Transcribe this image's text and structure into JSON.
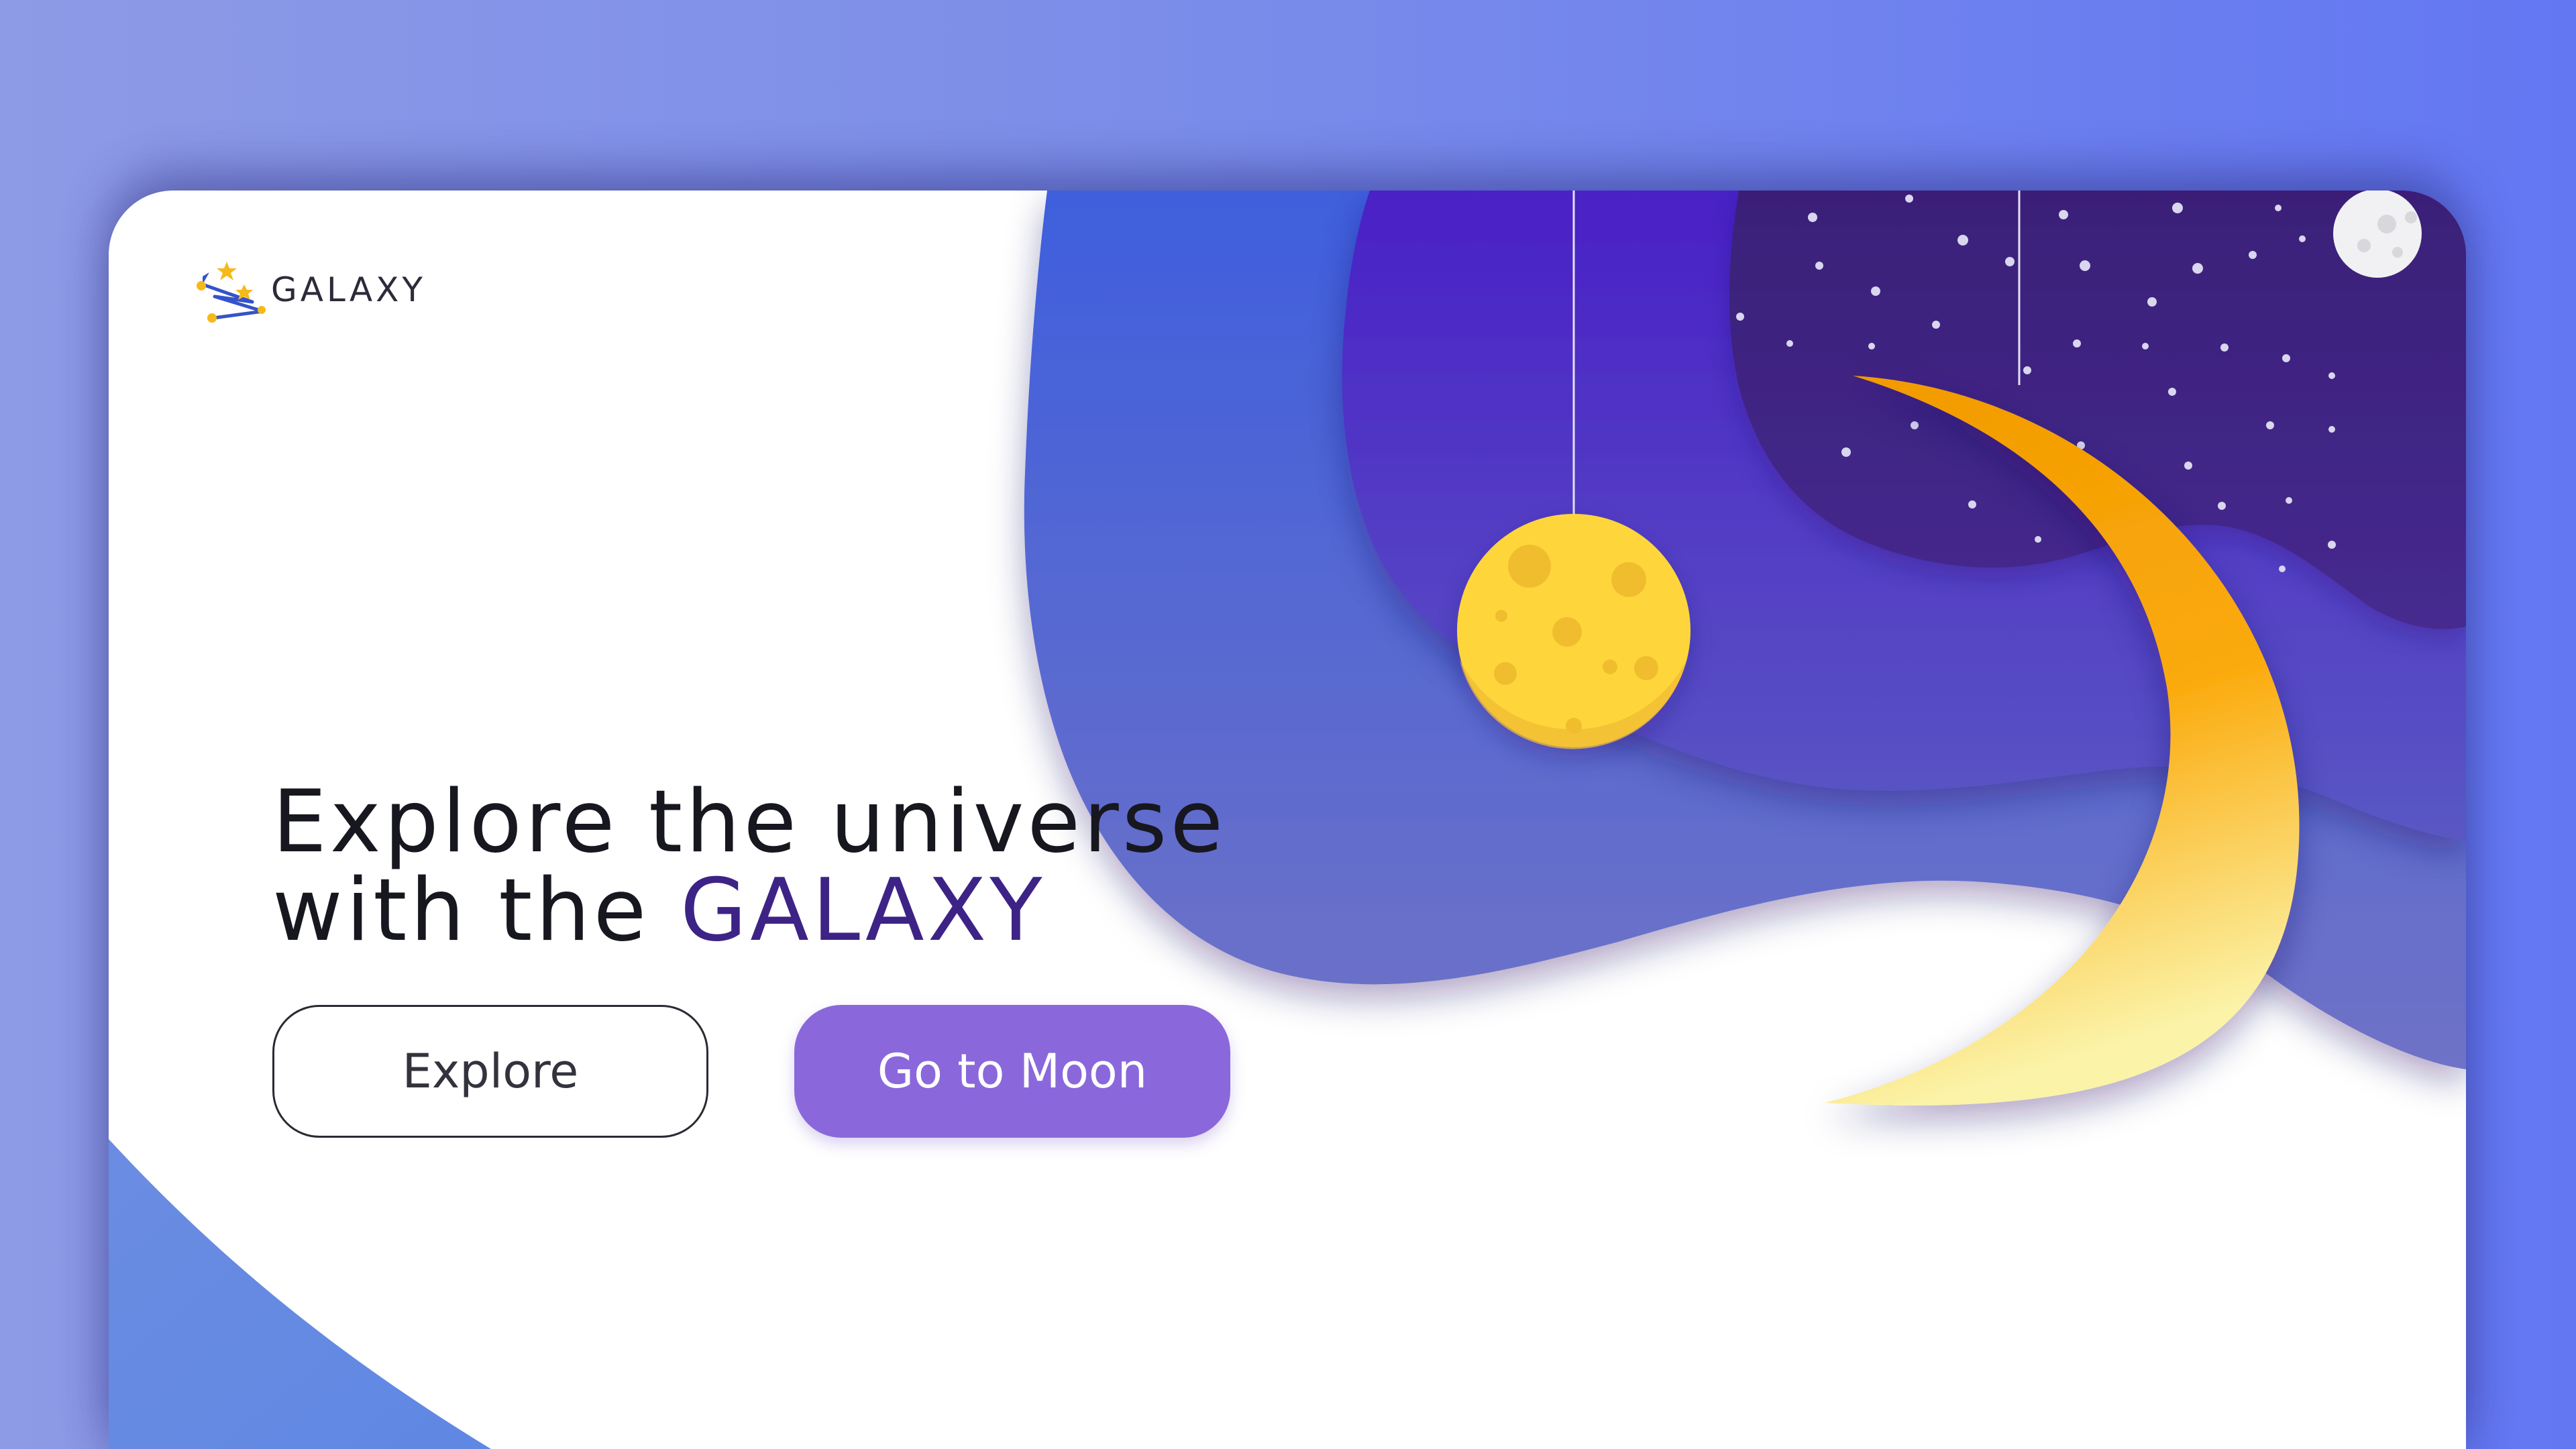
{
  "brand": {
    "name": "GALAXY",
    "logo_icon": "constellation-stars-icon"
  },
  "hero": {
    "headline_line1": "Explore the universe",
    "headline_line2_prefix": "with the ",
    "headline_brand": "GALAXY"
  },
  "actions": {
    "explore_label": "Explore",
    "moon_label": "Go to Moon"
  },
  "illustration": {
    "hanging_planet": "yellow-planet-icon",
    "crescent": "crescent-moon-icon",
    "full_moon": "grey-moon-icon",
    "stars": "stars-icon"
  },
  "colors": {
    "background_left": "#8d9ae6",
    "background_right": "#6377f3",
    "card": "#ffffff",
    "headline_brand": "#3d2386",
    "primary_button": "#8a68db",
    "wave_outer": "#4e63d6",
    "wave_middle": "#4b3fc8",
    "night_sky": "#3f2680",
    "planet": "#fed63a",
    "crescent": "#f7a300"
  }
}
